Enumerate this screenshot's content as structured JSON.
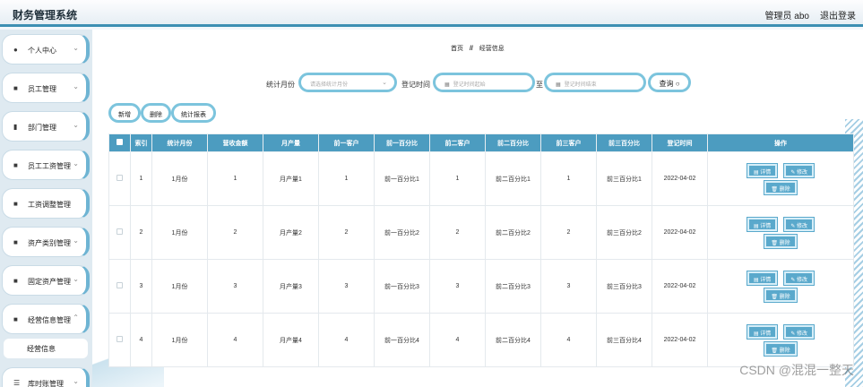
{
  "header": {
    "title": "财务管理系统",
    "user": "管理员 abo",
    "logout": "退出登录"
  },
  "sidebar": {
    "items": [
      {
        "icon": "●",
        "label": "个人中心"
      },
      {
        "icon": "■",
        "label": "员工管理"
      },
      {
        "icon": "▮",
        "label": "部门管理"
      },
      {
        "icon": "■",
        "label": "员工工资管理"
      },
      {
        "icon": "■",
        "label": "工资调整管理"
      },
      {
        "icon": "■",
        "label": "资产类别管理"
      },
      {
        "icon": "■",
        "label": "固定资产管理"
      },
      {
        "icon": "■",
        "label": "经营信息管理"
      },
      {
        "icon": "☰",
        "label": "库时账管理"
      }
    ],
    "submenu": "经营信息"
  },
  "breadcrumb": {
    "home": "首页",
    "sep": "//",
    "current": "经营信息"
  },
  "search": {
    "month_label": "统计月份",
    "month_placeholder": "请选择统计月份",
    "time_label": "登记时间",
    "start_placeholder": "登记时间起始",
    "to": "至",
    "end_placeholder": "登记时间结束",
    "query": "查询 ○"
  },
  "toolbar": {
    "add": "新增",
    "delete": "删除",
    "report": "统计报表"
  },
  "table": {
    "headers": [
      "索引",
      "统计月份",
      "营收金额",
      "月产量",
      "前一客户",
      "前一百分比",
      "前二客户",
      "前二百分比",
      "前三客户",
      "前三百分比",
      "登记时间",
      "操作"
    ],
    "rows": [
      [
        "1",
        "1月份",
        "1",
        "月产量1",
        "1",
        "前一百分比1",
        "1",
        "前二百分比1",
        "1",
        "前三百分比1",
        "2022-04-02"
      ],
      [
        "2",
        "1月份",
        "2",
        "月产量2",
        "2",
        "前一百分比2",
        "2",
        "前二百分比2",
        "2",
        "前三百分比2",
        "2022-04-02"
      ],
      [
        "3",
        "1月份",
        "3",
        "月产量3",
        "3",
        "前一百分比3",
        "3",
        "前二百分比3",
        "3",
        "前三百分比3",
        "2022-04-02"
      ],
      [
        "4",
        "1月份",
        "4",
        "月产量4",
        "4",
        "前一百分比4",
        "4",
        "前二百分比4",
        "4",
        "前三百分比4",
        "2022-04-02"
      ]
    ],
    "actions": {
      "detail": "▤ 详情",
      "edit": "✎ 修改",
      "delete": "🗑 删除"
    }
  },
  "watermark": "CSDN @混混一整天"
}
